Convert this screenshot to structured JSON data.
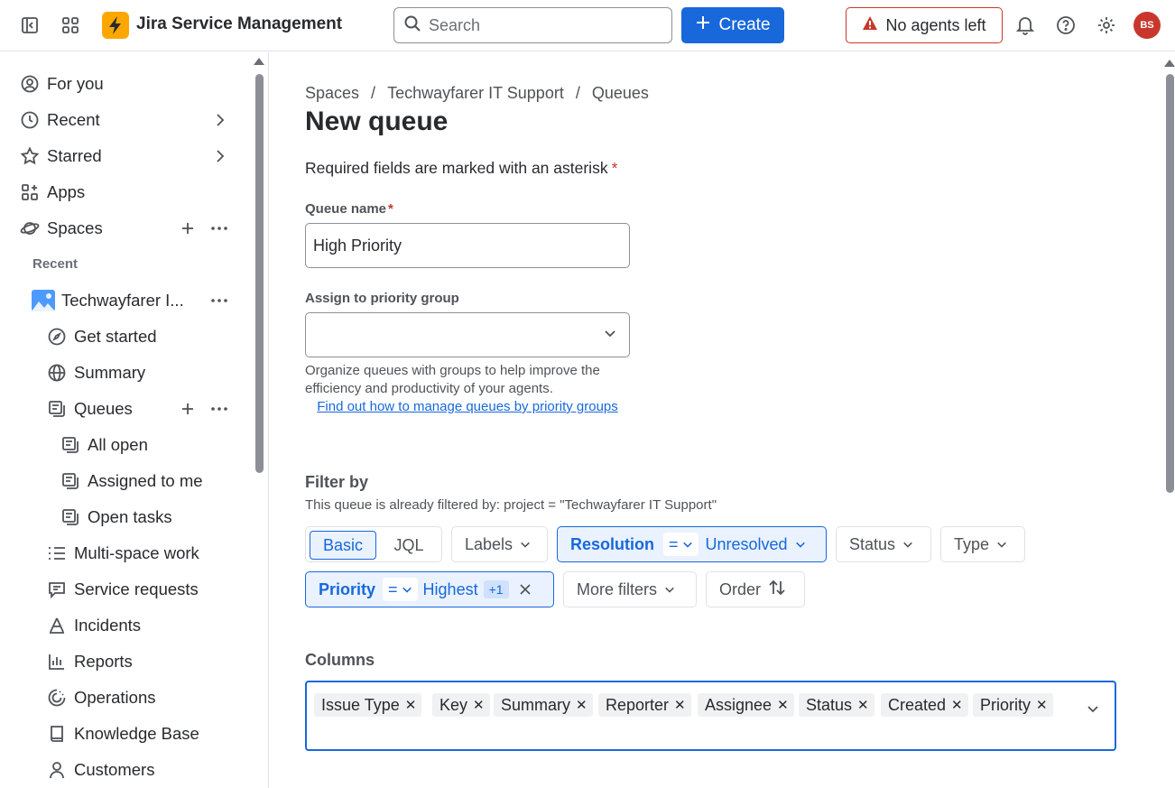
{
  "topbar": {
    "app_title": "Jira Service Management",
    "search_placeholder": "Search",
    "create_label": "Create",
    "agents_label": "No agents left",
    "avatar_initials": "BS"
  },
  "sidebar": {
    "for_you": "For you",
    "recent": "Recent",
    "starred": "Starred",
    "apps": "Apps",
    "spaces": "Spaces",
    "recent_heading": "Recent",
    "space_name": "Techwayfarer I...",
    "get_started": "Get started",
    "summary": "Summary",
    "queues": "Queues",
    "all_open": "All open",
    "assigned_to_me": "Assigned to me",
    "open_tasks": "Open tasks",
    "multi_space_work": "Multi-space work",
    "service_requests": "Service requests",
    "incidents": "Incidents",
    "reports": "Reports",
    "operations": "Operations",
    "knowledge_base": "Knowledge Base",
    "customers": "Customers"
  },
  "breadcrumb": {
    "spaces": "Spaces",
    "sep1": "/",
    "project": "Techwayfarer IT Support",
    "sep2": "/",
    "queues": "Queues"
  },
  "form": {
    "title": "New queue",
    "required_note": "Required fields are marked with an asterisk",
    "asterisk": "*",
    "queue_name_label": "Queue name",
    "queue_name_value": "High Priority",
    "priority_group_label": "Assign to priority group",
    "priority_group_value": "",
    "group_help": "Organize queues with groups to help improve the efficiency and productivity of your agents.",
    "group_link": "Find out how to manage queues by priority groups"
  },
  "filter": {
    "title": "Filter by",
    "prefilter": "This queue is already filtered by:  project = \"Techwayfarer IT Support\"",
    "basic": "Basic",
    "jql": "JQL",
    "labels": "Labels",
    "resolution": "Resolution",
    "resolution_op": "=",
    "resolution_value": "Unresolved",
    "status": "Status",
    "type": "Type",
    "priority": "Priority",
    "priority_op": "=",
    "priority_value": "Highest",
    "priority_more": "+1",
    "more_filters": "More filters",
    "order": "Order"
  },
  "columns": {
    "title": "Columns",
    "tags": [
      "Issue Type",
      "Key",
      "Summary",
      "Reporter",
      "Assignee",
      "Status",
      "Created",
      "Priority"
    ]
  },
  "colors": {
    "accent": "#1868db",
    "danger": "#c9372c",
    "logo": "#fca700"
  }
}
